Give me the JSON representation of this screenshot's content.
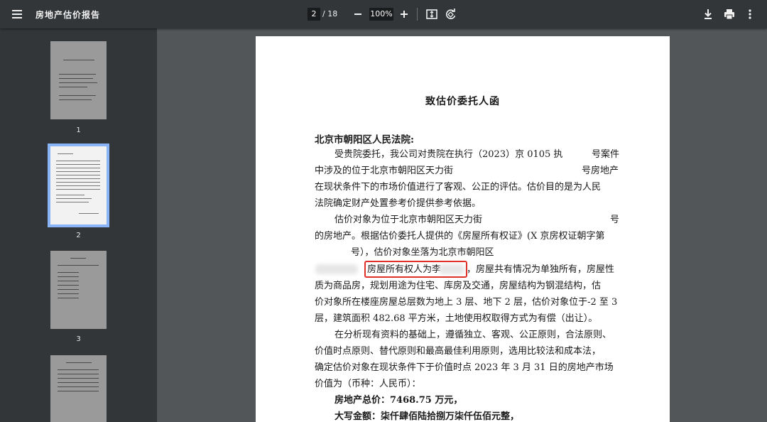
{
  "toolbar": {
    "title": "房地产估价报告",
    "current_page": "2",
    "total_pages": "/ 18",
    "zoom": "100%"
  },
  "icons": {
    "menu": "hamburger-menu-icon",
    "fit": "fit-to-page-icon",
    "rotate": "rotate-icon",
    "download": "download-icon",
    "print": "print-icon",
    "more": "more-vertical-icon"
  },
  "sidebar": {
    "thumbnails": [
      {
        "number": "1"
      },
      {
        "number": "2"
      },
      {
        "number": "3"
      }
    ]
  },
  "document": {
    "heading": "致估价委托人函",
    "addressee": "北京市朝阳区人民法院:",
    "lines": [
      "受贵院委托，我公司对贵院在执行（2023）京 0105 执",
      "号案件",
      "中涉及的位于北京市朝阳区天力街",
      "号房地产",
      "在现状条件下的市场价值进行了客观、公正的评估。估价目的是为人民",
      "法院确定财产处置参考价提供参考依据。",
      "估价对象为位于北京市朝阳区天力街",
      "号",
      "的房地产。根据估价委托人提供的《房屋所有权证》(X 京房权证朝字第",
      "号），估价对象坐落为北京市朝阳区",
      "房屋所有权人为李",
      "，房屋共有情况为单独所有，房屋性",
      "质为商品房，规划用途为住宅、库房及交通，房屋结构为钢混结构，估",
      "价对象所在楼座房屋总层数为地上 3 层、地下 2 层，估价对象位于-2 至 3",
      "层，建筑面积 482.68 平方米，土地使用权取得方式为有偿（出让）。",
      "在分析现有资料的基础上，遵循独立、客观、公正原则，合法原则、",
      "价值时点原则、替代原则和最高最佳利用原则，选用比较法和成本法，",
      "确定估价对象在现状条件下于价值时点 2023 年 3 月 31 日的房地产市场",
      "价值为（币种：人民币）："
    ],
    "total_price": "房地产总价：7468.75 万元，",
    "capital_amount": "大写金额：柒仟肆佰陆拾捌万柒仟伍佰元整，"
  },
  "colors": {
    "toolbar_bg": "#323639",
    "viewer_bg": "#525659",
    "selection": "#8ab4f8",
    "highlight_box": "#e0302a"
  }
}
